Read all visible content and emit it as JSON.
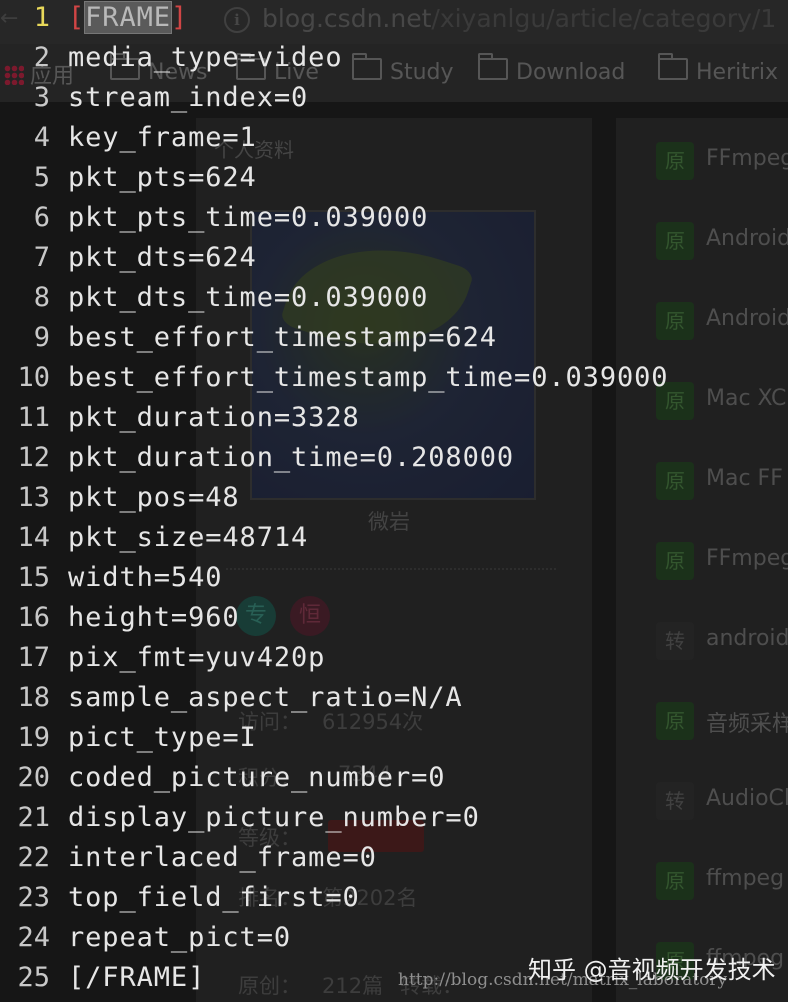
{
  "browser": {
    "url_domain": "blog.csdn.net",
    "url_path": "/xiyanlgu/article/category/1",
    "bookmarks": [
      {
        "label": "应用",
        "icon": "apps-icon"
      },
      {
        "label": "News",
        "icon": "folder-icon"
      },
      {
        "label": "Live",
        "icon": "folder-icon"
      },
      {
        "label": "Study",
        "icon": "folder-icon"
      },
      {
        "label": "Download",
        "icon": "folder-icon"
      },
      {
        "label": "Heritrix",
        "icon": "folder-icon"
      }
    ]
  },
  "profile": {
    "heading": "个人资料",
    "name": "微岩",
    "badges": [
      "专",
      "恒"
    ],
    "stats": {
      "visits_label": "访问：",
      "visits_value": "612954次",
      "points_label": "积分：",
      "points_value": "7344",
      "level_label": "等级：",
      "rank_label": "排名：",
      "rank_value": "第2202名",
      "original_label": "原创：",
      "original_value": "212篇",
      "repost_label": "转载："
    }
  },
  "articles": [
    {
      "tag": "原",
      "type": "original",
      "title": "FFmpeg"
    },
    {
      "tag": "原",
      "type": "original",
      "title": "Android"
    },
    {
      "tag": "原",
      "type": "original",
      "title": "Android"
    },
    {
      "tag": "原",
      "type": "original",
      "title": "Mac XC"
    },
    {
      "tag": "原",
      "type": "original",
      "title": "Mac FF"
    },
    {
      "tag": "原",
      "type": "original",
      "title": "FFmpeg"
    },
    {
      "tag": "转",
      "type": "repost",
      "title": "android"
    },
    {
      "tag": "原",
      "type": "original",
      "title": "音频采样"
    },
    {
      "tag": "转",
      "type": "repost",
      "title": "AudioCl"
    },
    {
      "tag": "原",
      "type": "original",
      "title": "ffmpeg"
    },
    {
      "tag": "原",
      "type": "original",
      "title": "ffmpeg"
    }
  ],
  "terminal": {
    "lines": [
      {
        "n": "1",
        "text": "[FRAME]"
      },
      {
        "n": "2",
        "text": "media_type=video"
      },
      {
        "n": "3",
        "text": "stream_index=0"
      },
      {
        "n": "4",
        "text": "key_frame=1"
      },
      {
        "n": "5",
        "text": "pkt_pts=624"
      },
      {
        "n": "6",
        "text": "pkt_pts_time=0.039000"
      },
      {
        "n": "7",
        "text": "pkt_dts=624"
      },
      {
        "n": "8",
        "text": "pkt_dts_time=0.039000"
      },
      {
        "n": "9",
        "text": "best_effort_timestamp=624"
      },
      {
        "n": "10",
        "text": "best_effort_timestamp_time=0.039000"
      },
      {
        "n": "11",
        "text": "pkt_duration=3328"
      },
      {
        "n": "12",
        "text": "pkt_duration_time=0.208000"
      },
      {
        "n": "13",
        "text": "pkt_pos=48"
      },
      {
        "n": "14",
        "text": "pkt_size=48714"
      },
      {
        "n": "15",
        "text": "width=540"
      },
      {
        "n": "16",
        "text": "height=960"
      },
      {
        "n": "17",
        "text": "pix_fmt=yuv420p"
      },
      {
        "n": "18",
        "text": "sample_aspect_ratio=N/A"
      },
      {
        "n": "19",
        "text": "pict_type=I"
      },
      {
        "n": "20",
        "text": "coded_picture_number=0"
      },
      {
        "n": "21",
        "text": "display_picture_number=0"
      },
      {
        "n": "22",
        "text": "interlaced_frame=0"
      },
      {
        "n": "23",
        "text": "top_field_first=0"
      },
      {
        "n": "24",
        "text": "repeat_pict=0"
      },
      {
        "n": "25",
        "text": "[/FRAME]"
      }
    ]
  },
  "watermarks": {
    "zhihu": "知乎 @音视频开发技术",
    "csdn": "http://blog.csdn.net/matrix_laboratory"
  },
  "colors": {
    "line_number_current": "#e8d85a",
    "bracket_match": "#d04545",
    "original_tag": "#254a24"
  }
}
